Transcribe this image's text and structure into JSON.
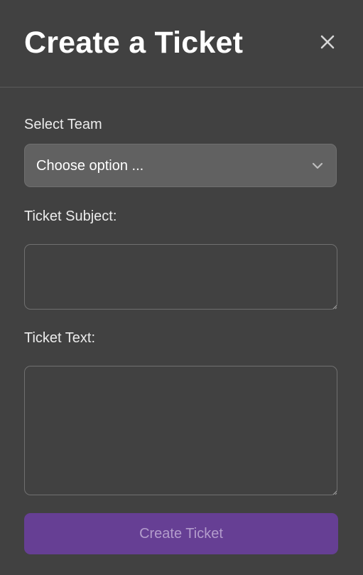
{
  "dialog": {
    "title": "Create a Ticket",
    "close_icon": "close-icon"
  },
  "form": {
    "team_label": "Select Team",
    "team_select": {
      "selected": "Choose option ...",
      "icon": "chevron-down-icon"
    },
    "subject_label": "Ticket Subject:",
    "subject_value": "",
    "text_label": "Ticket Text:",
    "text_value": "",
    "submit_label": "Create Ticket"
  },
  "colors": {
    "background": "#414141",
    "select_background": "#616161",
    "accent": "#663f94",
    "accent_text": "#b39ccc"
  }
}
